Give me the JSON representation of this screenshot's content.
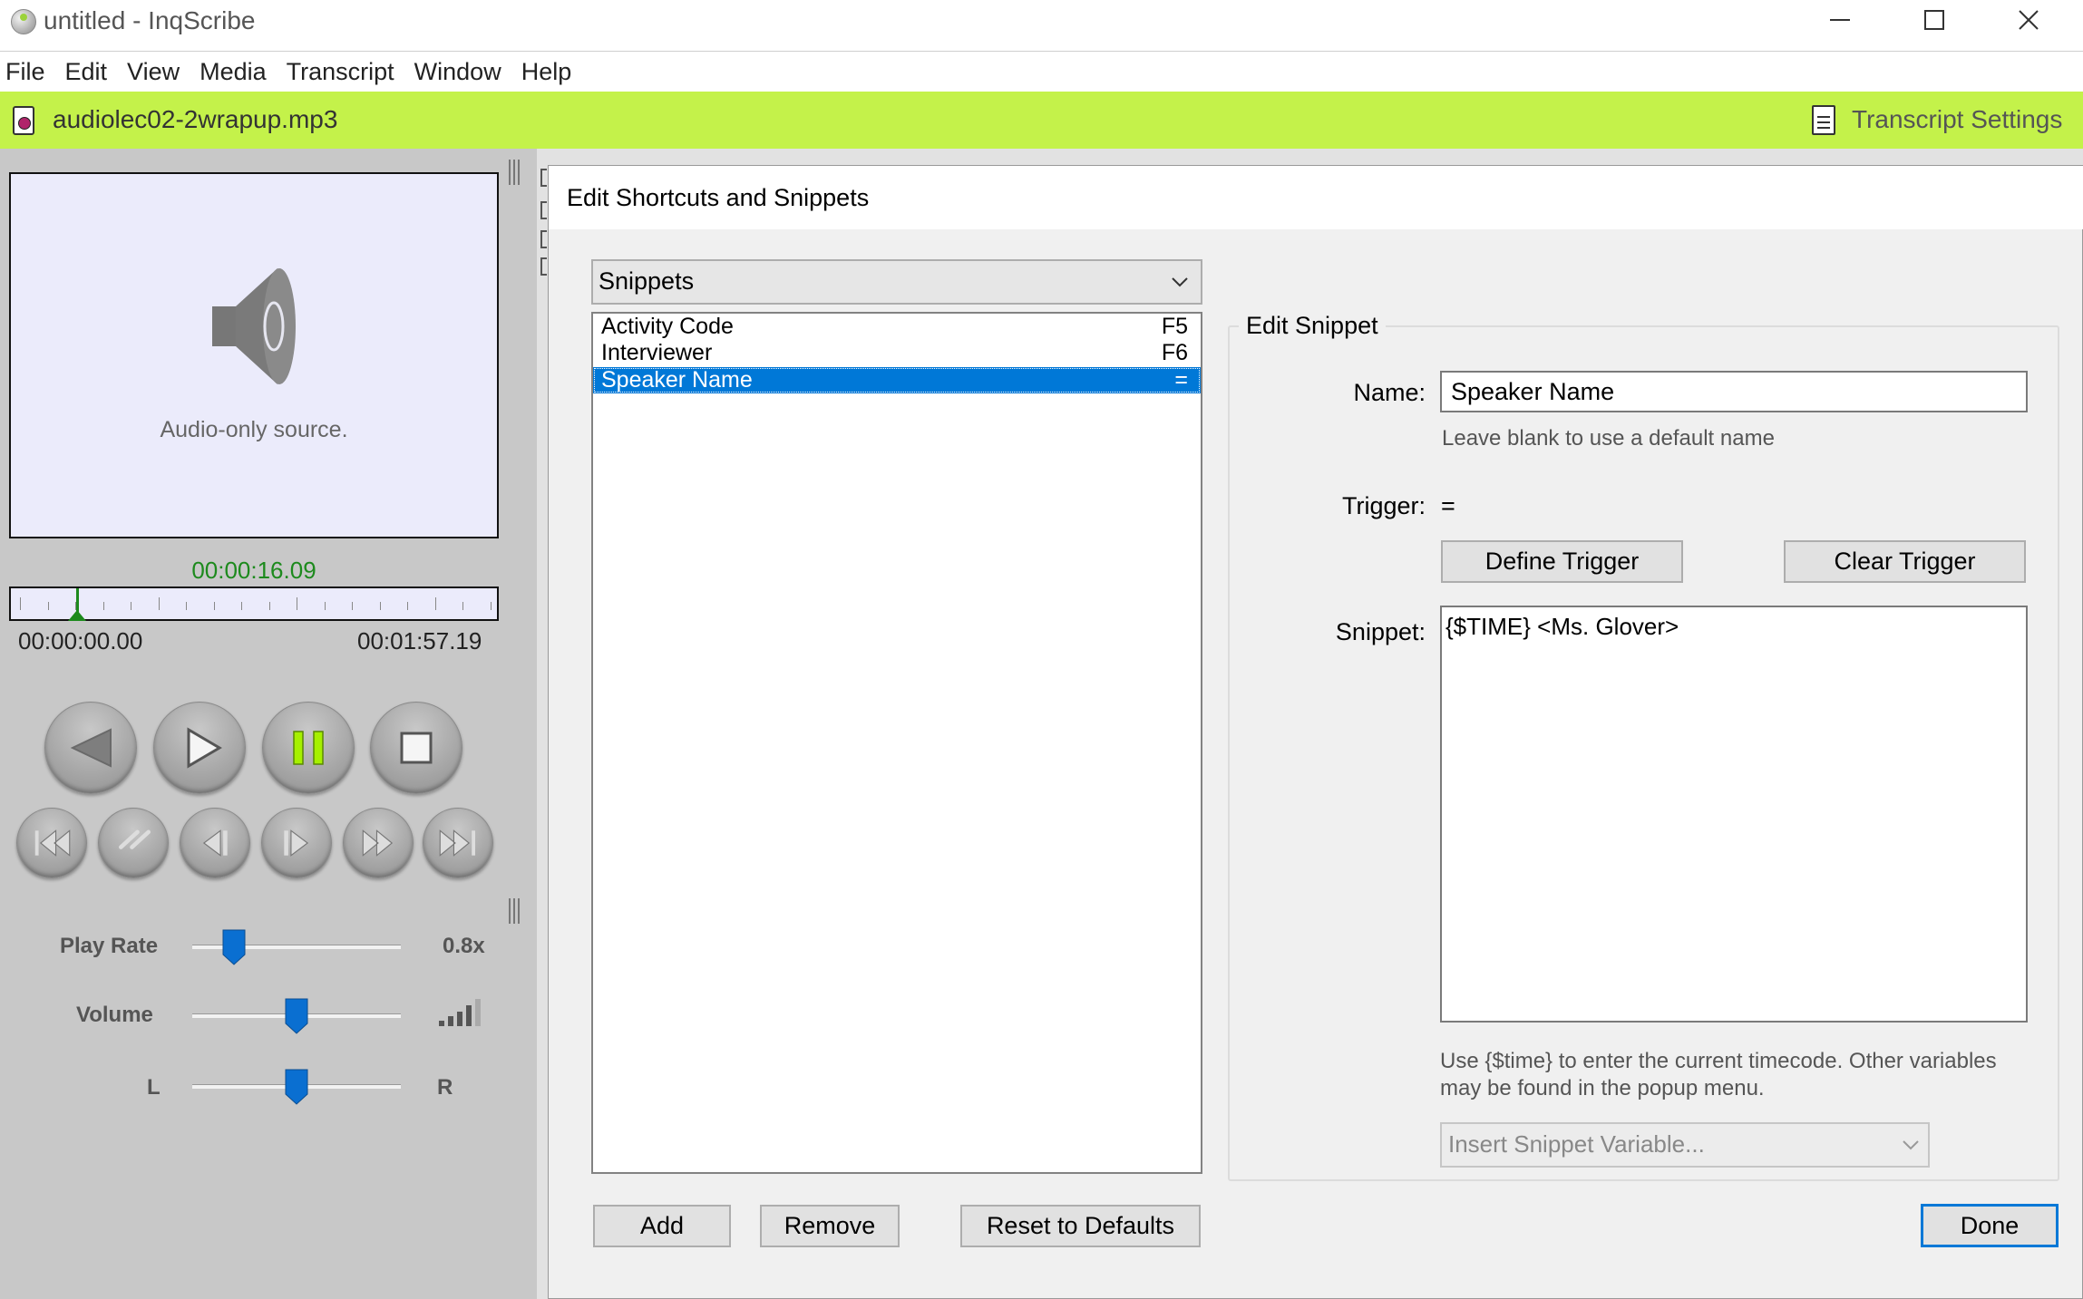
{
  "window": {
    "title": "untitled - InqScribe"
  },
  "menu": [
    "File",
    "Edit",
    "View",
    "Media",
    "Transcript",
    "Window",
    "Help"
  ],
  "filebar": {
    "file_name": "audiolec02-2wrapup.mp3",
    "settings_label": "Transcript Settings",
    "background": "#c4f24a"
  },
  "player": {
    "audio_only_text": "Audio-only source.",
    "current_time": "00:00:16.09",
    "start_time": "00:00:00.00",
    "end_time": "00:01:57.19",
    "position_fraction": 0.137,
    "play_rate_label": "Play Rate",
    "play_rate_value": "0.8x",
    "play_rate_fraction": 0.2,
    "volume_label": "Volume",
    "volume_fraction": 0.5,
    "balance_left": "L",
    "balance_right": "R",
    "balance_fraction": 0.5
  },
  "dialog": {
    "title": "Edit Shortcuts and Snippets",
    "category": "Snippets",
    "items": [
      {
        "name": "Activity Code",
        "key": "F5",
        "selected": false
      },
      {
        "name": "Interviewer",
        "key": "F6",
        "selected": false
      },
      {
        "name": "Speaker Name",
        "key": "=",
        "selected": true
      }
    ],
    "add_label": "Add",
    "remove_label": "Remove",
    "reset_label": "Reset to Defaults",
    "done_label": "Done",
    "edit_group_title": "Edit Snippet",
    "name_label": "Name:",
    "name_value": "Speaker Name",
    "name_hint": "Leave blank to use a default name",
    "trigger_label": "Trigger:",
    "trigger_value": "=",
    "define_trigger_label": "Define Trigger",
    "clear_trigger_label": "Clear Trigger",
    "snippet_label": "Snippet:",
    "snippet_value": "{$TIME} <Ms. Glover>",
    "variables_help": "Use {$time} to enter the current timecode. Other variables may be found in the popup menu.",
    "variable_select_label": "Insert Snippet Variable...",
    "accent": "#0078d7"
  }
}
